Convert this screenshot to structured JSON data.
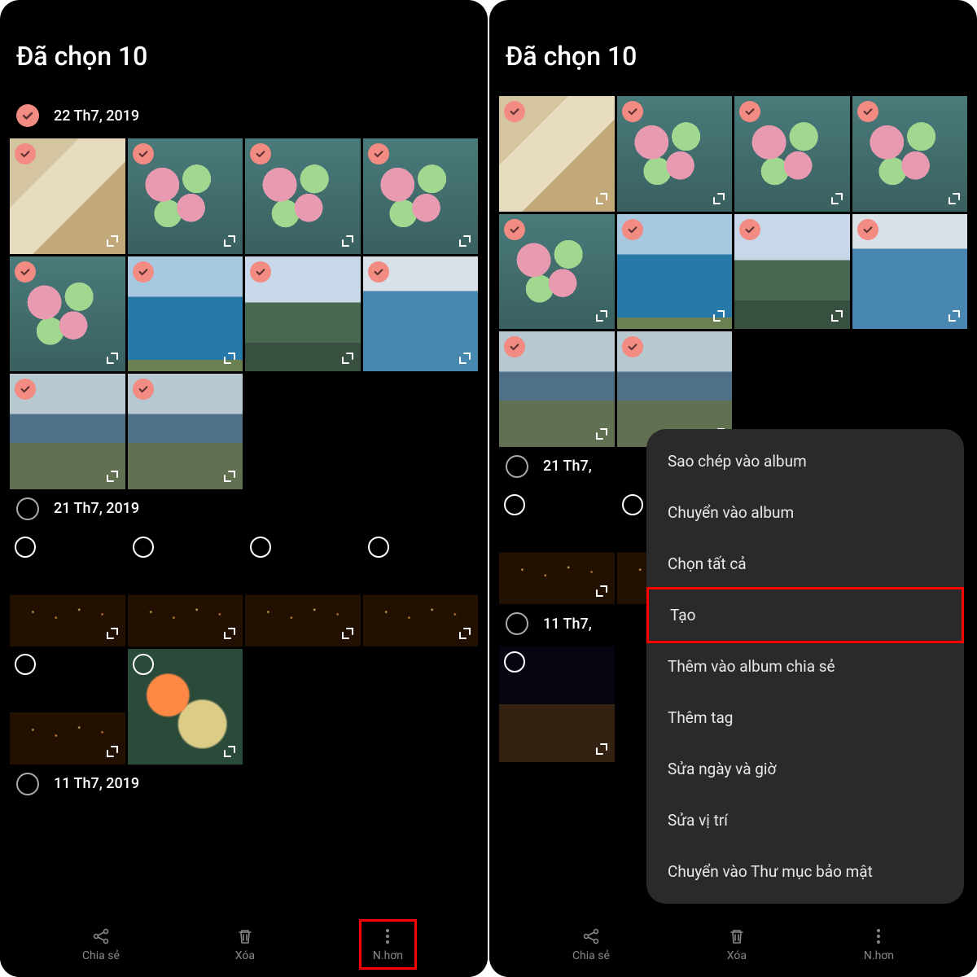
{
  "left": {
    "title": "Đã chọn 10",
    "sections": [
      {
        "date": "22 Th7, 2019",
        "checked": true,
        "thumbs": [
          {
            "checked": true,
            "kind": "boba"
          },
          {
            "checked": true,
            "kind": "popsicle"
          },
          {
            "checked": true,
            "kind": "popsicle"
          },
          {
            "checked": true,
            "kind": "popsicle"
          },
          {
            "checked": true,
            "kind": "popsicle"
          },
          {
            "checked": true,
            "kind": "sea"
          },
          {
            "checked": true,
            "kind": "mountain"
          },
          {
            "checked": true,
            "kind": "ocean"
          },
          {
            "checked": true,
            "kind": "coast"
          },
          {
            "checked": true,
            "kind": "coast"
          }
        ]
      },
      {
        "date": "21 Th7, 2019",
        "checked": false,
        "thumbs": [
          {
            "checked": false,
            "kind": "night"
          },
          {
            "checked": false,
            "kind": "night"
          },
          {
            "checked": false,
            "kind": "night"
          },
          {
            "checked": false,
            "kind": "night"
          },
          {
            "checked": false,
            "kind": "night"
          },
          {
            "checked": false,
            "kind": "food"
          }
        ]
      },
      {
        "date": "11 Th7, 2019",
        "checked": false,
        "thumbs": []
      }
    ],
    "bottom": {
      "share": "Chia sẻ",
      "delete": "Xóa",
      "more": "N.hơn"
    }
  },
  "right": {
    "title": "Đã chọn 10",
    "sections": [
      {
        "date": "",
        "checked": true,
        "thumbs": [
          {
            "checked": true,
            "kind": "boba"
          },
          {
            "checked": true,
            "kind": "popsicle"
          },
          {
            "checked": true,
            "kind": "popsicle"
          },
          {
            "checked": true,
            "kind": "popsicle"
          },
          {
            "checked": true,
            "kind": "popsicle"
          },
          {
            "checked": true,
            "kind": "sea"
          },
          {
            "checked": true,
            "kind": "mountain"
          },
          {
            "checked": true,
            "kind": "ocean"
          },
          {
            "checked": true,
            "kind": "coast"
          },
          {
            "checked": true,
            "kind": "coast"
          }
        ]
      },
      {
        "date": "21 Th7,",
        "checked": false,
        "thumbs": [
          {
            "checked": false,
            "kind": "night"
          },
          {
            "checked": false,
            "kind": "night"
          }
        ]
      },
      {
        "date": "11 Th7,",
        "checked": false,
        "thumbs": [
          {
            "checked": false,
            "kind": "nightbuilding"
          }
        ]
      }
    ],
    "bottom": {
      "share": "Chia sẻ",
      "delete": "Xóa",
      "more": "N.hơn"
    },
    "popup": [
      {
        "label": "Sao chép vào album",
        "hl": false
      },
      {
        "label": "Chuyển vào album",
        "hl": false
      },
      {
        "label": "Chọn tất cả",
        "hl": false
      },
      {
        "label": "Tạo",
        "hl": true
      },
      {
        "label": "Thêm vào album chia sẻ",
        "hl": false
      },
      {
        "label": "Thêm tag",
        "hl": false
      },
      {
        "label": "Sửa ngày và giờ",
        "hl": false
      },
      {
        "label": "Sửa vị trí",
        "hl": false
      },
      {
        "label": "Chuyển vào Thư mục bảo mật",
        "hl": false
      }
    ]
  }
}
